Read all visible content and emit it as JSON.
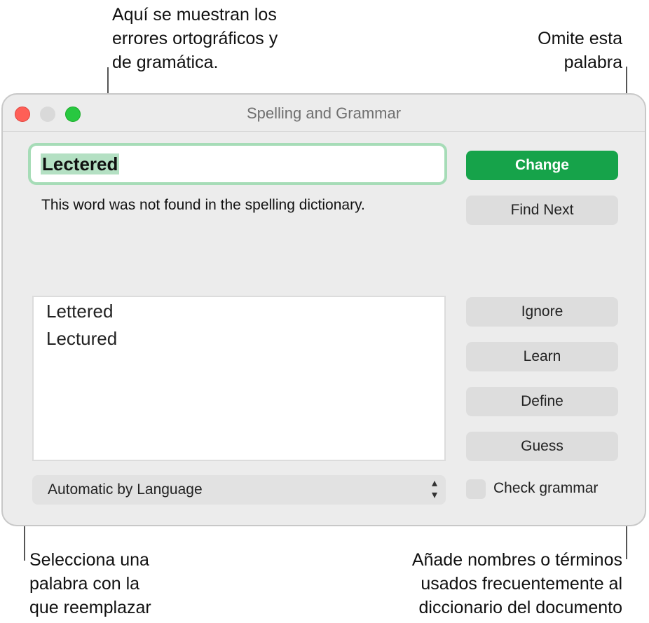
{
  "callouts": {
    "top": "Aquí se muestran los\nerrores ortográficos y\nde gramática.",
    "top_right": "Omite esta\npalabra",
    "bottom_left": "Selecciona una\npalabra con la\nque reemplazar",
    "bottom_right": "Añade nombres o términos\nusados frecuentemente al\ndiccionario del documento"
  },
  "window": {
    "title": "Spelling and Grammar",
    "misspelled_word": "Lectered",
    "message": "This word was not found in the spelling dictionary.",
    "suggestions": [
      "Lettered",
      "Lectured"
    ],
    "language": "Automatic by Language",
    "buttons": {
      "change": "Change",
      "find_next": "Find Next",
      "ignore": "Ignore",
      "learn": "Learn",
      "define": "Define",
      "guess": "Guess"
    },
    "check_grammar": {
      "label": "Check grammar",
      "checked": false
    }
  },
  "colors": {
    "accent": "#16a34a",
    "focus_ring": "#a6dcb7",
    "close": "#fe5f57",
    "zoom": "#28c840"
  },
  "icons": {
    "close": "close-icon",
    "minimize": "minimize-icon",
    "zoom": "zoom-icon",
    "popup_arrows": "chevron-up-down-icon"
  }
}
